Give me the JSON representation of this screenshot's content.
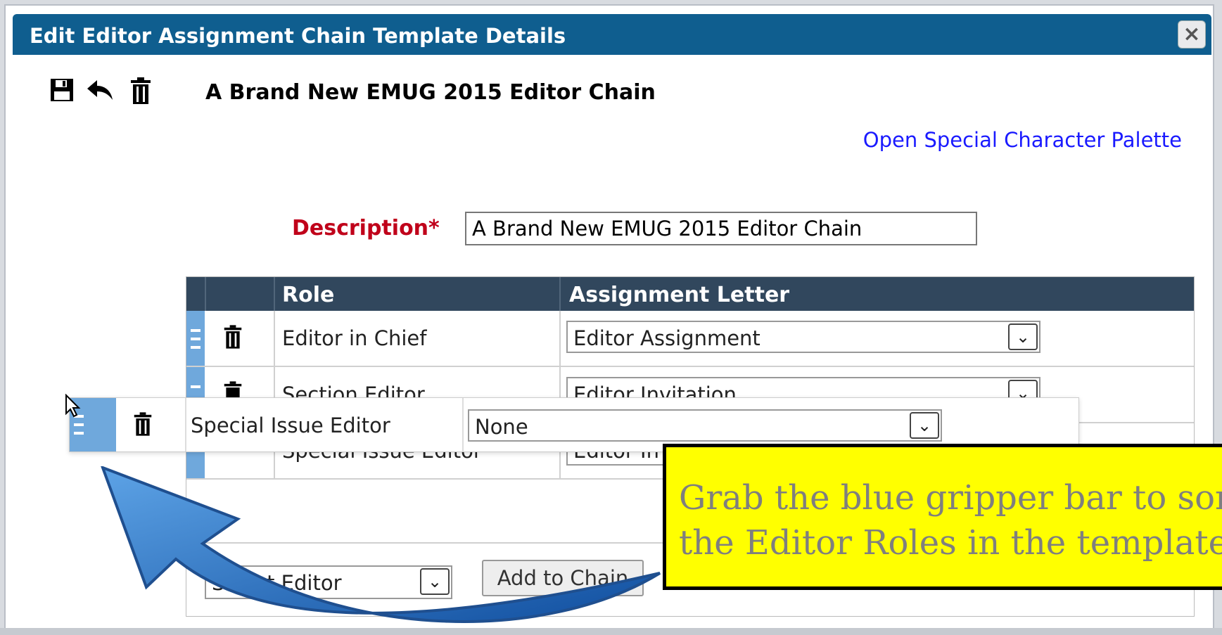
{
  "dialog": {
    "title": "Edit Editor Assignment Chain Template Details",
    "close_icon": "close-icon",
    "chain_title": "A Brand New EMUG 2015 Editor Chain",
    "palette_link": "Open Special Character Palette",
    "description_label": "Description*",
    "description_value": "A Brand New EMUG 2015 Editor Chain"
  },
  "toolbar": {
    "icons": [
      "save-icon",
      "undo-icon",
      "trash-icon"
    ]
  },
  "table": {
    "headers": {
      "role": "Role",
      "letter": "Assignment Letter"
    },
    "rows": [
      {
        "role": "Editor in Chief",
        "letter": "Editor Assignment"
      },
      {
        "role": "Section Editor",
        "letter": "Editor Invitation"
      },
      {
        "role": "Special Issue Editor",
        "letter": "Editor In"
      }
    ]
  },
  "dragging_row": {
    "role": "Special Issue Editor",
    "letter": "None"
  },
  "add": {
    "select_value": "Select Editor",
    "button_label": "Add to Chain"
  },
  "callout": {
    "text": "Grab the blue gripper bar to sort\nthe Editor Roles in the template."
  },
  "colors": {
    "titlebar": "#0f5e8f",
    "header": "#31475d",
    "gripper": "#6fa8dc",
    "callout_bg": "#ffff00",
    "required_label": "#c0001a",
    "link": "#1a1aff"
  }
}
